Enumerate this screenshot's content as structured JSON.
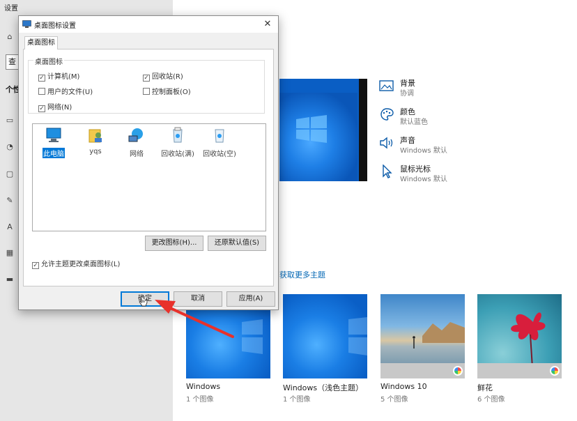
{
  "settings": {
    "title": "设置",
    "search_text": "查",
    "section_title": "个性",
    "sidebar_icons": [
      "home-icon",
      "picture-icon",
      "palette-icon",
      "lockscreen-icon",
      "brush-icon",
      "font-icon",
      "start-icon",
      "taskbar-icon"
    ]
  },
  "options": [
    {
      "title": "背景",
      "sub": "协调",
      "icon": "picture-icon"
    },
    {
      "title": "颜色",
      "sub": "默认蓝色",
      "icon": "palette-icon"
    },
    {
      "title": "声音",
      "sub": "Windows 默认",
      "icon": "speaker-icon"
    },
    {
      "title": "鼠标光标",
      "sub": "Windows 默认",
      "icon": "cursor-icon"
    }
  ],
  "more_themes_link": "获取更多主题",
  "themes": [
    {
      "name": "Windows",
      "count": "1 个图像"
    },
    {
      "name": "Windows（浅色主题）",
      "count": "1 个图像"
    },
    {
      "name": "Windows 10",
      "count": "5 个图像"
    },
    {
      "name": "鲜花",
      "count": "6 个图像"
    }
  ],
  "dialog": {
    "title": "桌面图标设置",
    "tab": "桌面图标",
    "group_title": "桌面图标",
    "checkboxes": [
      {
        "label": "计算机(M)",
        "checked": true
      },
      {
        "label": "回收站(R)",
        "checked": true
      },
      {
        "label": "用户的文件(U)",
        "checked": false
      },
      {
        "label": "控制面板(O)",
        "checked": false
      },
      {
        "label": "网络(N)",
        "checked": true
      }
    ],
    "icons": [
      {
        "label": "此电脑",
        "selected": true
      },
      {
        "label": "yqs",
        "selected": false
      },
      {
        "label": "网络",
        "selected": false
      },
      {
        "label": "回收站(满)",
        "selected": false
      },
      {
        "label": "回收站(空)",
        "selected": false
      }
    ],
    "change_icon_button": "更改图标(H)...",
    "restore_default_button": "还原默认值(S)",
    "allow_theme_label": "允许主题更改桌面图标(L)",
    "allow_theme_checked": true,
    "ok_button": "确定",
    "cancel_button": "取消",
    "apply_button": "应用(A)"
  },
  "colors": {
    "accent": "#0078d7",
    "arrow": "#e8312b"
  }
}
